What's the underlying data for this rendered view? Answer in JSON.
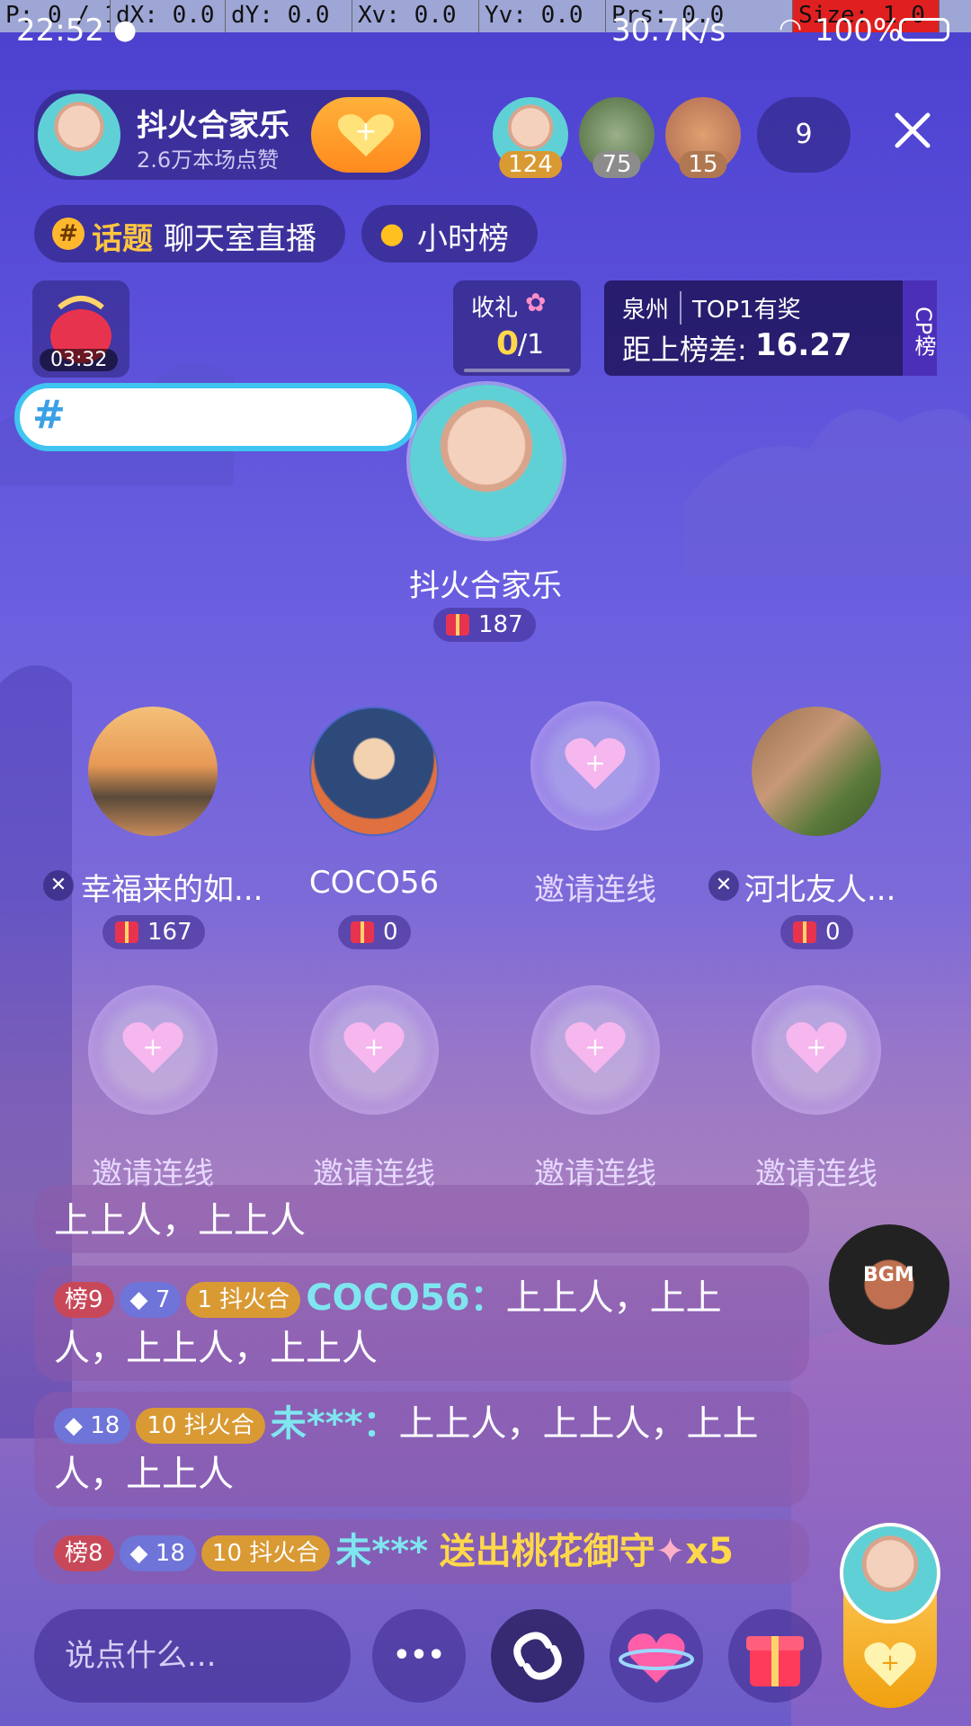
{
  "debug": {
    "p": "P: 0 / 1",
    "dx": "dX: 0.0",
    "dy": "dY: 0.0",
    "xv": "Xv: 0.0",
    "yv": "Yv: 0.0",
    "prs": "Prs: 0.0",
    "size": "Size: 1.0"
  },
  "status": {
    "time": "22:52",
    "speed": "30.7K/s",
    "battery": "100%"
  },
  "host": {
    "name": "抖火合家乐",
    "likes": "2.6万本场点赞"
  },
  "top_viewers": [
    {
      "count": "124"
    },
    {
      "count": "75"
    },
    {
      "count": "15"
    }
  ],
  "viewer_count": "9",
  "topic": {
    "label": "话题",
    "text": "聊天室直播"
  },
  "hour_rank": "小时榜",
  "timer": "03:32",
  "gift_task": {
    "label": "收礼",
    "progress": "0",
    "total": "/1"
  },
  "rank_card": {
    "city": "泉州",
    "reward": "TOP1有奖",
    "gap_label": "距上榜差:",
    "gap_value": "16.27",
    "side": "CP榜"
  },
  "hash_bubble": "#",
  "center_host": {
    "name": "抖火合家乐",
    "gifts": "187"
  },
  "seats_row1": [
    {
      "name": "幸福来的如...",
      "gifts": "167"
    },
    {
      "name": "COCO56",
      "gifts": "0"
    },
    {
      "name": "邀请连线"
    },
    {
      "name": "河北友人...",
      "gifts": "0"
    }
  ],
  "seats_row2": [
    "邀请连线",
    "邀请连线",
    "邀请连线",
    "邀请连线"
  ],
  "chat": [
    {
      "text": "上上人，上上人"
    },
    {
      "rank": "榜9",
      "level": "7",
      "fan_level": "1",
      "fan": "抖火合",
      "user": "COCO56：",
      "text": "上上人，上上人，上上人，上上人"
    },
    {
      "level": "18",
      "fan_level": "10",
      "fan": "抖火合",
      "user": "未***：",
      "text": "上上人，上上人，上上人，上上人"
    },
    {
      "rank": "榜8",
      "level": "18",
      "fan_level": "10",
      "fan": "抖火合",
      "user": "未***",
      "text": "送出桃花御守",
      "times": "x5"
    }
  ],
  "input_placeholder": "说点什么...",
  "more_label": "•••"
}
